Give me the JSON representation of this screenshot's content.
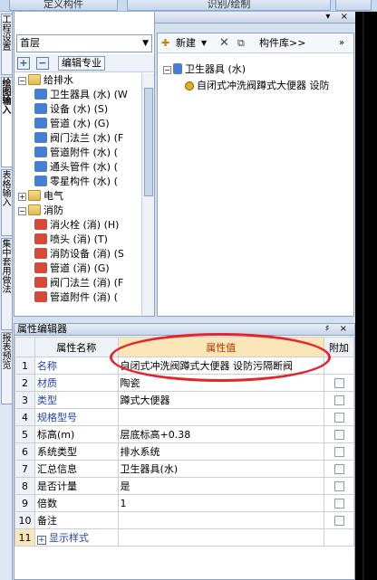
{
  "topbar": {
    "btn1": "定义构件",
    "btn2": "识别/绘制"
  },
  "vtabs": [
    {
      "label": "工程设置"
    },
    {
      "label": "绘图输入"
    },
    {
      "label": "表格输入"
    },
    {
      "label": "集中套用做法"
    },
    {
      "label": "报表预览"
    }
  ],
  "left_panel": {
    "title": "定义",
    "floor": "首层",
    "edit_button": "编辑专业",
    "tree": [
      {
        "label": "给排水",
        "level": 0,
        "expander": "−",
        "icon": "folder"
      },
      {
        "label": "卫生器具 (水) (W",
        "level": 1,
        "icon": "blue"
      },
      {
        "label": "设备 (水) (S)",
        "level": 1,
        "icon": "blue"
      },
      {
        "label": "管道 (水) (G)",
        "level": 1,
        "icon": "blue"
      },
      {
        "label": "阀门法兰 (水) (F",
        "level": 1,
        "icon": "blue"
      },
      {
        "label": "管道附件 (水) (",
        "level": 1,
        "icon": "blue"
      },
      {
        "label": "通头管件 (水) (",
        "level": 1,
        "icon": "blue"
      },
      {
        "label": "零星构件 (水) (",
        "level": 1,
        "icon": "blue"
      },
      {
        "label": "电气",
        "level": 0,
        "expander": "+",
        "icon": "folder"
      },
      {
        "label": "消防",
        "level": 0,
        "expander": "−",
        "icon": "folder"
      },
      {
        "label": "消火栓 (消) (H)",
        "level": 1,
        "icon": "red"
      },
      {
        "label": "喷头 (消) (T)",
        "level": 1,
        "icon": "red"
      },
      {
        "label": "消防设备 (消) (S",
        "level": 1,
        "icon": "red"
      },
      {
        "label": "管道 (消) (G)",
        "level": 1,
        "icon": "red"
      },
      {
        "label": "阀门法兰 (消) (F",
        "level": 1,
        "icon": "red"
      },
      {
        "label": "管道附件 (消) (",
        "level": 1,
        "icon": "red"
      }
    ]
  },
  "right_panel": {
    "new_button": "新建",
    "library_button": "构件库>>",
    "tree": [
      {
        "label": "卫生器具 (水)",
        "level": 0,
        "expander": "−"
      },
      {
        "label": "自闭式冲洗阀蹲式大便器 设防",
        "level": 1
      }
    ]
  },
  "property_editor": {
    "title": "属性编辑器",
    "headers": {
      "name": "属性名称",
      "value": "属性值",
      "extra": "附加"
    },
    "rows": [
      {
        "num": "1",
        "name": "名称",
        "value": "自闭式冲洗阀蹲式大便器 设防污隔断阀",
        "blue": true,
        "check": false
      },
      {
        "num": "2",
        "name": "材质",
        "value": "陶瓷",
        "blue": true,
        "check": true
      },
      {
        "num": "3",
        "name": "类型",
        "value": "蹲式大便器",
        "blue": true,
        "check": true
      },
      {
        "num": "4",
        "name": "规格型号",
        "value": "",
        "blue": true,
        "check": true
      },
      {
        "num": "5",
        "name": "标高(m)",
        "value": "层底标高+0.38",
        "blue": false,
        "check": true
      },
      {
        "num": "6",
        "name": "系统类型",
        "value": "排水系统",
        "blue": false,
        "check": true
      },
      {
        "num": "7",
        "name": "汇总信息",
        "value": "卫生器具(水)",
        "blue": false,
        "check": true
      },
      {
        "num": "8",
        "name": "是否计量",
        "value": "是",
        "blue": false,
        "check": true
      },
      {
        "num": "9",
        "name": "倍数",
        "value": "1",
        "blue": false,
        "check": true
      },
      {
        "num": "10",
        "name": "备注",
        "value": "",
        "blue": false,
        "check": true
      },
      {
        "num": "11",
        "name": "显示样式",
        "value": "",
        "blue": true,
        "check": false,
        "expander": "+"
      }
    ]
  }
}
